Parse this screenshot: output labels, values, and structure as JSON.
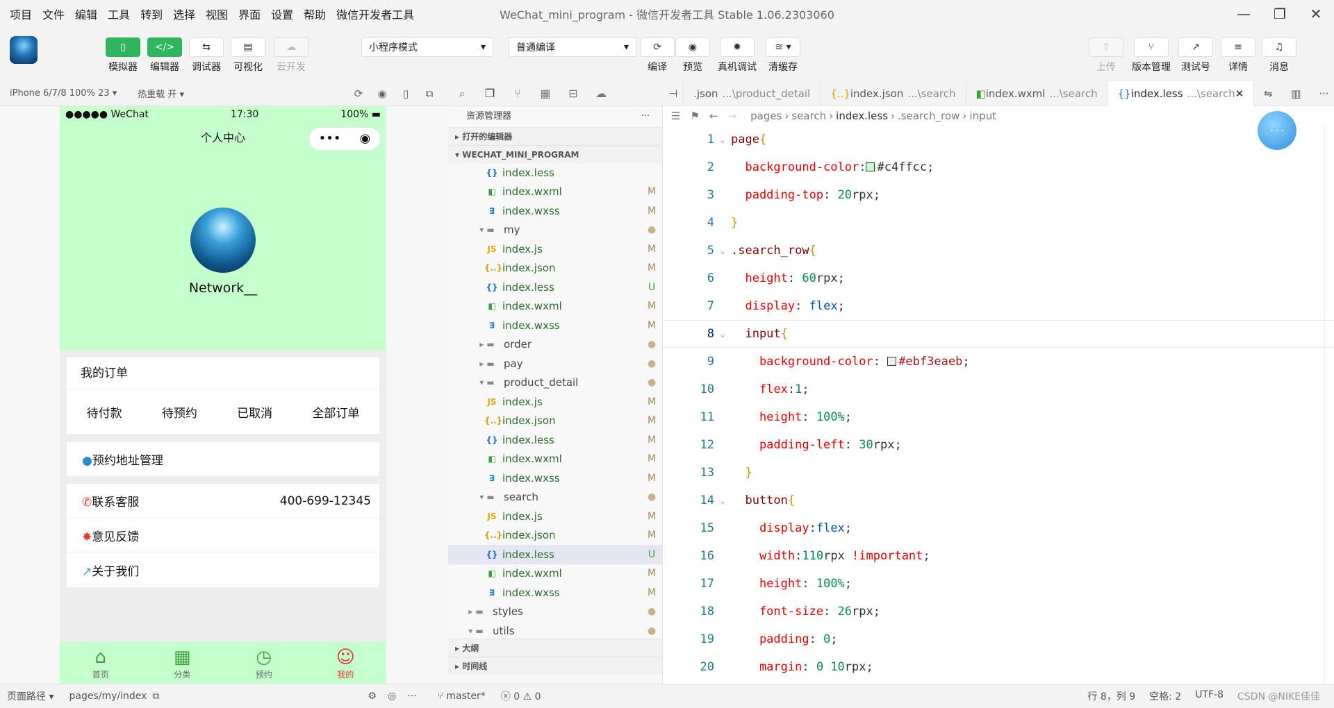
{
  "menu": [
    "项目",
    "文件",
    "编辑",
    "工具",
    "转到",
    "选择",
    "视图",
    "界面",
    "设置",
    "帮助",
    "微信开发者工具"
  ],
  "window_title": "WeChat_mini_program - 微信开发者工具 Stable 1.06.2303060",
  "toolbar": {
    "left_buttons": [
      {
        "label": "模拟器",
        "icon": "phone-icon"
      },
      {
        "label": "编辑器",
        "icon": "code-icon"
      },
      {
        "label": "调试器",
        "icon": "debug-icon"
      },
      {
        "label": "可视化",
        "icon": "layout-icon"
      },
      {
        "label": "云开发",
        "icon": "cloud-icon"
      }
    ],
    "mode_select": "小程序模式",
    "compile_select": "普通编译",
    "mid_buttons": [
      {
        "label": "编译",
        "icon": "refresh-icon"
      },
      {
        "label": "预览",
        "icon": "eye-icon"
      },
      {
        "label": "真机调试",
        "icon": "bug-icon"
      },
      {
        "label": "清缓存",
        "icon": "layers-icon"
      }
    ],
    "right_buttons": [
      {
        "label": "上传",
        "icon": "upload-icon"
      },
      {
        "label": "版本管理",
        "icon": "branch-icon"
      },
      {
        "label": "测试号",
        "icon": "external-link-icon"
      },
      {
        "label": "详情",
        "icon": "menu-icon"
      },
      {
        "label": "消息",
        "icon": "bell-icon"
      }
    ]
  },
  "simulator": {
    "device": "iPhone 6/7/8 100% 23",
    "hot_reload": "热重载 开",
    "status_left": "●●●●● WeChat",
    "status_time": "17:30",
    "status_battery": "100%",
    "nav_title": "个人中心",
    "username": "Network__",
    "orders_title": "我的订单",
    "order_tabs": [
      "待付款",
      "待预约",
      "已取消",
      "全部订单"
    ],
    "address": "预约地址管理",
    "service": "联系客服",
    "service_phone": "400-699-12345",
    "feedback": "意见反馈",
    "about": "关于我们",
    "tabbar": [
      {
        "label": "首页",
        "icon": "home-icon"
      },
      {
        "label": "分类",
        "icon": "grid-icon"
      },
      {
        "label": "预约",
        "icon": "clock-icon"
      },
      {
        "label": "我的",
        "icon": "person-icon"
      }
    ],
    "bg_color": "#c4ffcc"
  },
  "explorer": {
    "title": "资源管理器",
    "open_editors": "打开的编辑器",
    "project": "WECHAT_MINI_PROGRAM",
    "outline": "大纲",
    "timeline": "时间线",
    "files": [
      {
        "name": "index.less",
        "type": "less",
        "status": "",
        "depth": 2
      },
      {
        "name": "index.wxml",
        "type": "wxml",
        "status": "M",
        "depth": 2
      },
      {
        "name": "index.wxss",
        "type": "wxss",
        "status": "M",
        "depth": 2
      },
      {
        "name": "my",
        "type": "folder-open",
        "status": "●",
        "depth": 1
      },
      {
        "name": "index.js",
        "type": "js",
        "status": "M",
        "depth": 2
      },
      {
        "name": "index.json",
        "type": "json",
        "status": "M",
        "depth": 2
      },
      {
        "name": "index.less",
        "type": "less",
        "status": "U",
        "depth": 2
      },
      {
        "name": "index.wxml",
        "type": "wxml",
        "status": "M",
        "depth": 2
      },
      {
        "name": "index.wxss",
        "type": "wxss",
        "status": "M",
        "depth": 2
      },
      {
        "name": "order",
        "type": "folder",
        "status": "●",
        "depth": 1
      },
      {
        "name": "pay",
        "type": "folder",
        "status": "●",
        "depth": 1
      },
      {
        "name": "product_detail",
        "type": "folder-open",
        "status": "●",
        "depth": 1
      },
      {
        "name": "index.js",
        "type": "js",
        "status": "M",
        "depth": 2
      },
      {
        "name": "index.json",
        "type": "json",
        "status": "M",
        "depth": 2
      },
      {
        "name": "index.less",
        "type": "less",
        "status": "M",
        "depth": 2
      },
      {
        "name": "index.wxml",
        "type": "wxml",
        "status": "M",
        "depth": 2
      },
      {
        "name": "index.wxss",
        "type": "wxss",
        "status": "M",
        "depth": 2
      },
      {
        "name": "search",
        "type": "folder-open",
        "status": "●",
        "depth": 1
      },
      {
        "name": "index.js",
        "type": "js",
        "status": "M",
        "depth": 2
      },
      {
        "name": "index.json",
        "type": "json",
        "status": "M",
        "depth": 2
      },
      {
        "name": "index.less",
        "type": "less",
        "status": "U",
        "depth": 2,
        "selected": true
      },
      {
        "name": "index.wxml",
        "type": "wxml",
        "status": "M",
        "depth": 2
      },
      {
        "name": "index.wxss",
        "type": "wxss",
        "status": "M",
        "depth": 2
      },
      {
        "name": "styles",
        "type": "folder",
        "status": "●",
        "depth": 0
      },
      {
        "name": "utils",
        "type": "folder-open",
        "status": "●",
        "depth": 0
      }
    ]
  },
  "tabs": [
    {
      "name": ".json",
      "dir": "...\\product_detail",
      "active": false
    },
    {
      "name": "index.json",
      "dir": "...\\search",
      "active": false
    },
    {
      "name": "index.wxml",
      "dir": "...\\search",
      "active": false
    },
    {
      "name": "index.less",
      "dir": "...\\search",
      "active": true
    }
  ],
  "breadcrumb": [
    "pages",
    "search",
    "index.less",
    ".search_row",
    "input"
  ],
  "code": [
    [
      [
        "page",
        "k-sel"
      ],
      [
        "{",
        "k-br"
      ]
    ],
    [
      [
        "  background-color",
        "k-prop"
      ],
      [
        ":",
        ""
      ],
      [
        "#c4ffcc",
        "swatch1"
      ],
      [
        ";",
        ""
      ]
    ],
    [
      [
        "  padding-top",
        "k-prop"
      ],
      [
        ": ",
        ""
      ],
      [
        "20",
        "k-num"
      ],
      [
        "rpx;",
        ""
      ]
    ],
    [
      [
        "}",
        "k-br"
      ]
    ],
    [
      [
        ".search_row",
        "k-sel"
      ],
      [
        "{",
        "k-br"
      ]
    ],
    [
      [
        "  height",
        "k-prop"
      ],
      [
        ": ",
        ""
      ],
      [
        "60",
        "k-num"
      ],
      [
        "rpx;",
        ""
      ]
    ],
    [
      [
        "  display",
        "k-prop"
      ],
      [
        ": ",
        ""
      ],
      [
        "flex",
        "k-val"
      ],
      [
        ";",
        ""
      ]
    ],
    [
      [
        "  input",
        "k-sel"
      ],
      [
        "{",
        "k-br"
      ]
    ],
    [
      [
        "    background-color",
        "k-prop"
      ],
      [
        ": ",
        ""
      ],
      [
        "#ebf3eaeb",
        "swatch2"
      ],
      [
        ";",
        ""
      ]
    ],
    [
      [
        "    flex",
        "k-prop"
      ],
      [
        ":",
        ""
      ],
      [
        "1",
        "k-num"
      ],
      [
        ";",
        ""
      ]
    ],
    [
      [
        "    height",
        "k-prop"
      ],
      [
        ": ",
        ""
      ],
      [
        "100%",
        "k-num"
      ],
      [
        ";",
        ""
      ]
    ],
    [
      [
        "    padding-left",
        "k-prop"
      ],
      [
        ": ",
        ""
      ],
      [
        "30",
        "k-num"
      ],
      [
        "rpx;",
        ""
      ]
    ],
    [
      [
        "  }",
        "k-br"
      ]
    ],
    [
      [
        "  button",
        "k-sel"
      ],
      [
        "{",
        "k-br"
      ]
    ],
    [
      [
        "    display",
        "k-prop"
      ],
      [
        ":",
        ""
      ],
      [
        "flex",
        "k-val"
      ],
      [
        ";",
        ""
      ]
    ],
    [
      [
        "    width",
        "k-prop"
      ],
      [
        ":",
        ""
      ],
      [
        "110",
        "k-num"
      ],
      [
        "rpx ",
        ""
      ],
      [
        "!important",
        "k-prop"
      ],
      [
        ";",
        ""
      ]
    ],
    [
      [
        "    height",
        "k-prop"
      ],
      [
        ": ",
        ""
      ],
      [
        "100%",
        "k-num"
      ],
      [
        ";",
        ""
      ]
    ],
    [
      [
        "    font-size",
        "k-prop"
      ],
      [
        ": ",
        ""
      ],
      [
        "26",
        "k-num"
      ],
      [
        "rpx;",
        ""
      ]
    ],
    [
      [
        "    padding",
        "k-prop"
      ],
      [
        ": ",
        ""
      ],
      [
        "0",
        "k-num"
      ],
      [
        ";",
        ""
      ]
    ],
    [
      [
        "    margin",
        "k-prop"
      ],
      [
        ": ",
        ""
      ],
      [
        "0 10",
        "k-num"
      ],
      [
        "rpx;",
        ""
      ]
    ]
  ],
  "statusbar": {
    "page_path_label": "页面路径",
    "page_path": "pages/my/index",
    "branch": "master*",
    "problems": "ⓧ 0 ⚠ 0",
    "cursor": "行 8，列 9",
    "spaces": "空格: 2",
    "encoding": "UTF-8",
    "watermark": "CSDN @NIKE佳佳"
  },
  "colors": {
    "accent": "#2fb55d",
    "phone_bg": "#c4ffcc"
  }
}
